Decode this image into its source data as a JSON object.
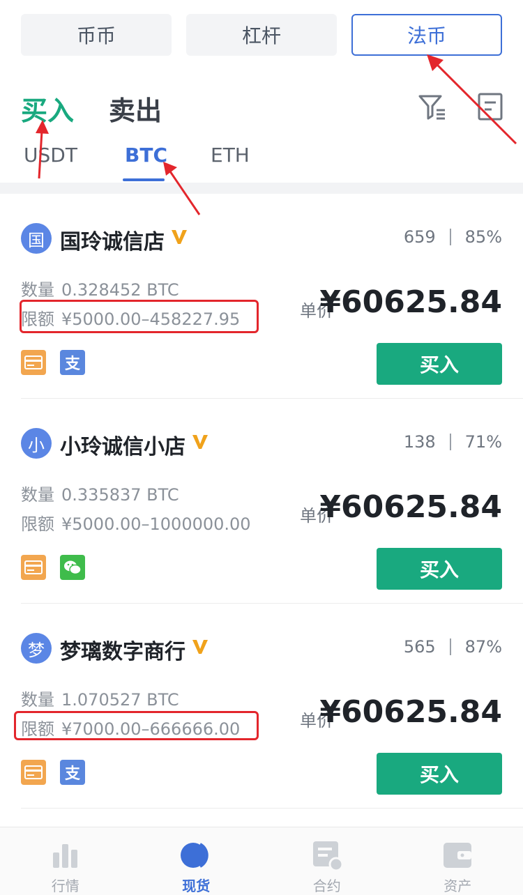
{
  "top_tabs": [
    {
      "label": "币币",
      "active": false
    },
    {
      "label": "杠杆",
      "active": false
    },
    {
      "label": "法币",
      "active": true
    }
  ],
  "side_tabs": {
    "buy": "买入",
    "sell": "卖出"
  },
  "coin_tabs": [
    {
      "label": "USDT",
      "active": false
    },
    {
      "label": "BTC",
      "active": true
    },
    {
      "label": "ETH",
      "active": false
    }
  ],
  "labels": {
    "quantity": "数量",
    "limit": "限额",
    "unit_price": "单价",
    "buy_button": "买入"
  },
  "merchants": [
    {
      "avatar": "国",
      "name": "国玲诚信店",
      "orders": "659",
      "completion": "85%",
      "quantity": "0.328452 BTC",
      "limit": "¥5000.00–458227.95",
      "price": "¥60625.84",
      "payments": [
        "bank-card-icon",
        "alipay-icon"
      ]
    },
    {
      "avatar": "小",
      "name": "小玲诚信小店",
      "orders": "138",
      "completion": "71%",
      "quantity": "0.335837 BTC",
      "limit": "¥5000.00–1000000.00",
      "price": "¥60625.84",
      "payments": [
        "bank-card-icon",
        "wechat-pay-icon"
      ]
    },
    {
      "avatar": "梦",
      "name": "梦璃数字商行",
      "orders": "565",
      "completion": "87%",
      "quantity": "1.070527 BTC",
      "limit": "¥7000.00–666666.00",
      "price": "¥60625.84",
      "payments": [
        "bank-card-icon",
        "alipay-icon"
      ]
    }
  ],
  "bottom_nav": [
    {
      "label": "行情",
      "icon": "bar-chart-icon",
      "active": false
    },
    {
      "label": "现货",
      "icon": "spot-circle-icon",
      "active": true
    },
    {
      "label": "合约",
      "icon": "contract-icon",
      "active": false
    },
    {
      "label": "资产",
      "icon": "wallet-icon",
      "active": false
    }
  ],
  "colors": {
    "accent_blue": "#3d6fd7",
    "buy_green": "#19a97f",
    "annotation_red": "#e3262c"
  }
}
